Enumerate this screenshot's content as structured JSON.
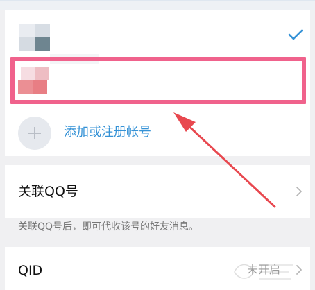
{
  "accounts": {
    "add_account_label": "添加或注册帐号"
  },
  "settings": {
    "link_qq_label": "关联QQ号",
    "link_qq_hint": "关联QQ号后，即可代收该号的好友消息。",
    "qid_label": "QID",
    "qid_status": "未开启"
  },
  "icons": [
    "check-icon",
    "plus-icon",
    "chevron-right-icon",
    "arrow-annotation"
  ],
  "colors": {
    "accent_blue": "#3592d6",
    "highlight_pink": "#f0628c",
    "arrow_red": "#e8484f"
  }
}
